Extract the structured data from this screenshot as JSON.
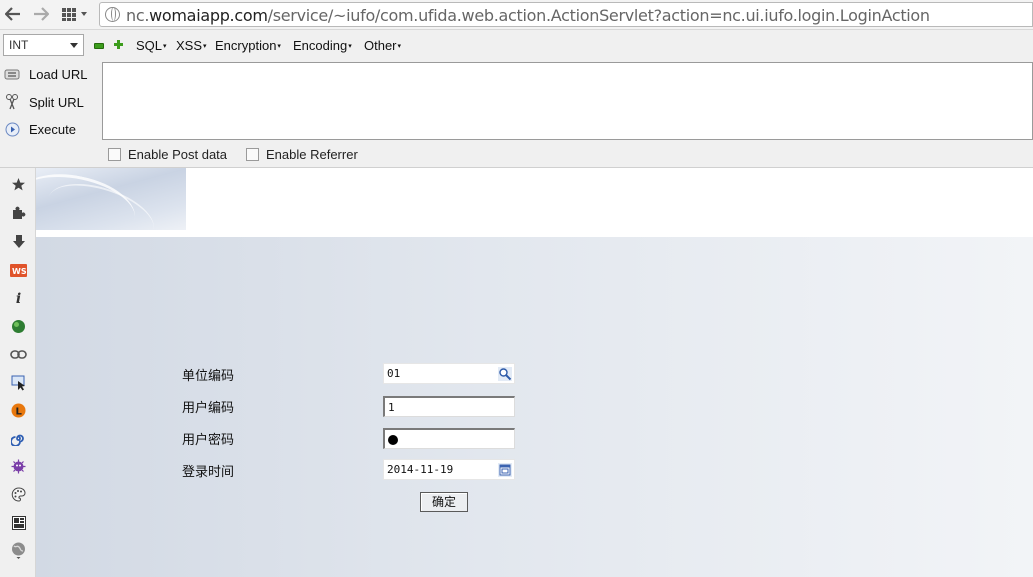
{
  "browser": {
    "url_prefix": "nc.",
    "url_domain": "womaiapp.com",
    "url_path": "/service/~iufo/com.ufida.web.action.ActionServlet?action=nc.ui.iufo.login.LoginAction"
  },
  "hackbar": {
    "type_select": "INT",
    "menus": [
      "SQL",
      "XSS",
      "Encryption",
      "Encoding",
      "Other"
    ],
    "buttons": {
      "load_url": "Load URL",
      "split_url": "Split URL",
      "execute": "Execute"
    },
    "url_text": "",
    "enable_post": "Enable Post data",
    "enable_referrer": "Enable Referrer"
  },
  "sidebar": {
    "icons": [
      "star-icon",
      "puzzle-icon",
      "download-icon",
      "ws-icon",
      "info-icon",
      "green-ball-icon",
      "chain-icon",
      "pointer-icon",
      "l-badge-icon",
      "spiral-icon",
      "bug-icon",
      "palette-icon",
      "grid-icon",
      "globe-icon"
    ]
  },
  "login": {
    "unit_code_label": "单位编码",
    "unit_code_value": "01",
    "user_code_label": "用户编码",
    "user_code_value": "1",
    "password_label": "用户密码",
    "login_time_label": "登录时间",
    "login_time_value": "2014-11-19",
    "ok_button": "确定"
  },
  "colors": {
    "accent_green": "#3c9c1c",
    "page_gradient_start": "#d2d9e4",
    "page_gradient_end": "#f2f4f7"
  }
}
